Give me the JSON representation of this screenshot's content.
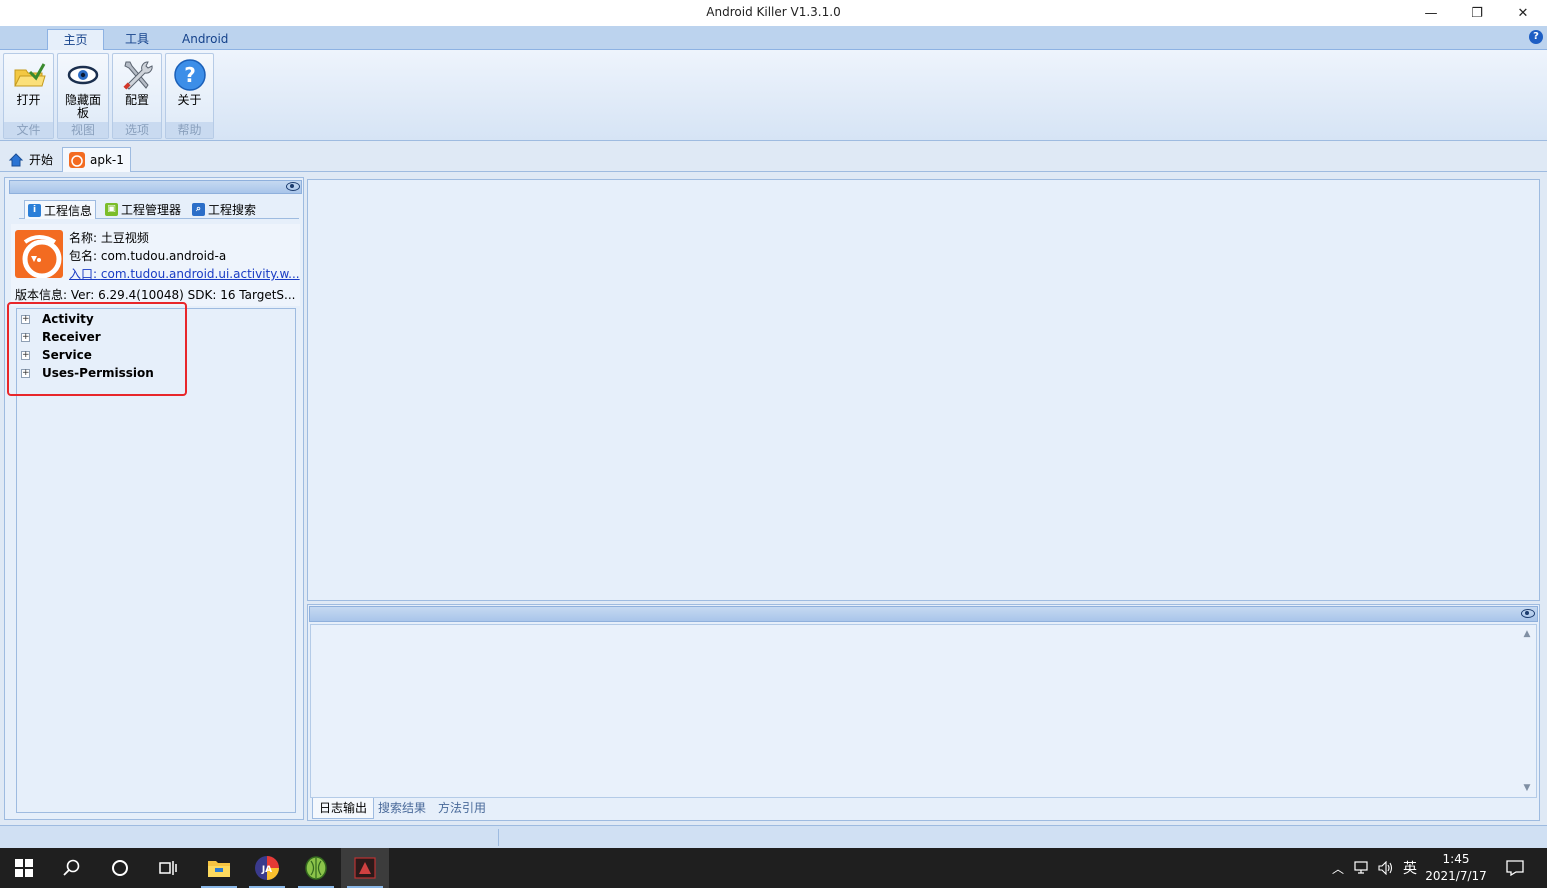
{
  "window": {
    "title": "Android Killer V1.3.1.0",
    "minimize": "—",
    "restore": "❐",
    "close": "✕"
  },
  "ribbon_tabs": [
    "主页",
    "工具",
    "Android"
  ],
  "ribbon_groups": [
    {
      "button": "打开",
      "group": "文件",
      "icon": "open-folder-icon"
    },
    {
      "button": "隐藏面板",
      "group": "视图",
      "icon": "eye-icon"
    },
    {
      "button": "配置",
      "group": "选项",
      "icon": "tools-icon"
    },
    {
      "button": "关于",
      "group": "帮助",
      "icon": "question-icon"
    }
  ],
  "doc_tabs": {
    "start": "开始",
    "apk": "apk-1"
  },
  "project_tabs": [
    "工程信息",
    "工程管理器",
    "工程搜索"
  ],
  "app_info": {
    "name_label": "名称:",
    "name": "土豆视频",
    "package_label": "包名:",
    "package": "com.tudou.android-a",
    "entry_label": "入口:",
    "entry": "com.tudou.android.ui.activity.w...",
    "version_line": "版本信息: Ver: 6.29.4(10048) SDK: 16 TargetS..."
  },
  "tree_nodes": [
    "Activity",
    "Receiver",
    "Service",
    "Uses-Permission"
  ],
  "output_tabs": [
    "日志输出",
    "搜索结果",
    "方法引用"
  ],
  "taskbar": {
    "input_method": "英",
    "time": "1:45",
    "date": "2021/7/17"
  },
  "colors": {
    "accent": "#15428b",
    "highlight_box": "#e8262a",
    "app_logo": "#f36b21"
  }
}
